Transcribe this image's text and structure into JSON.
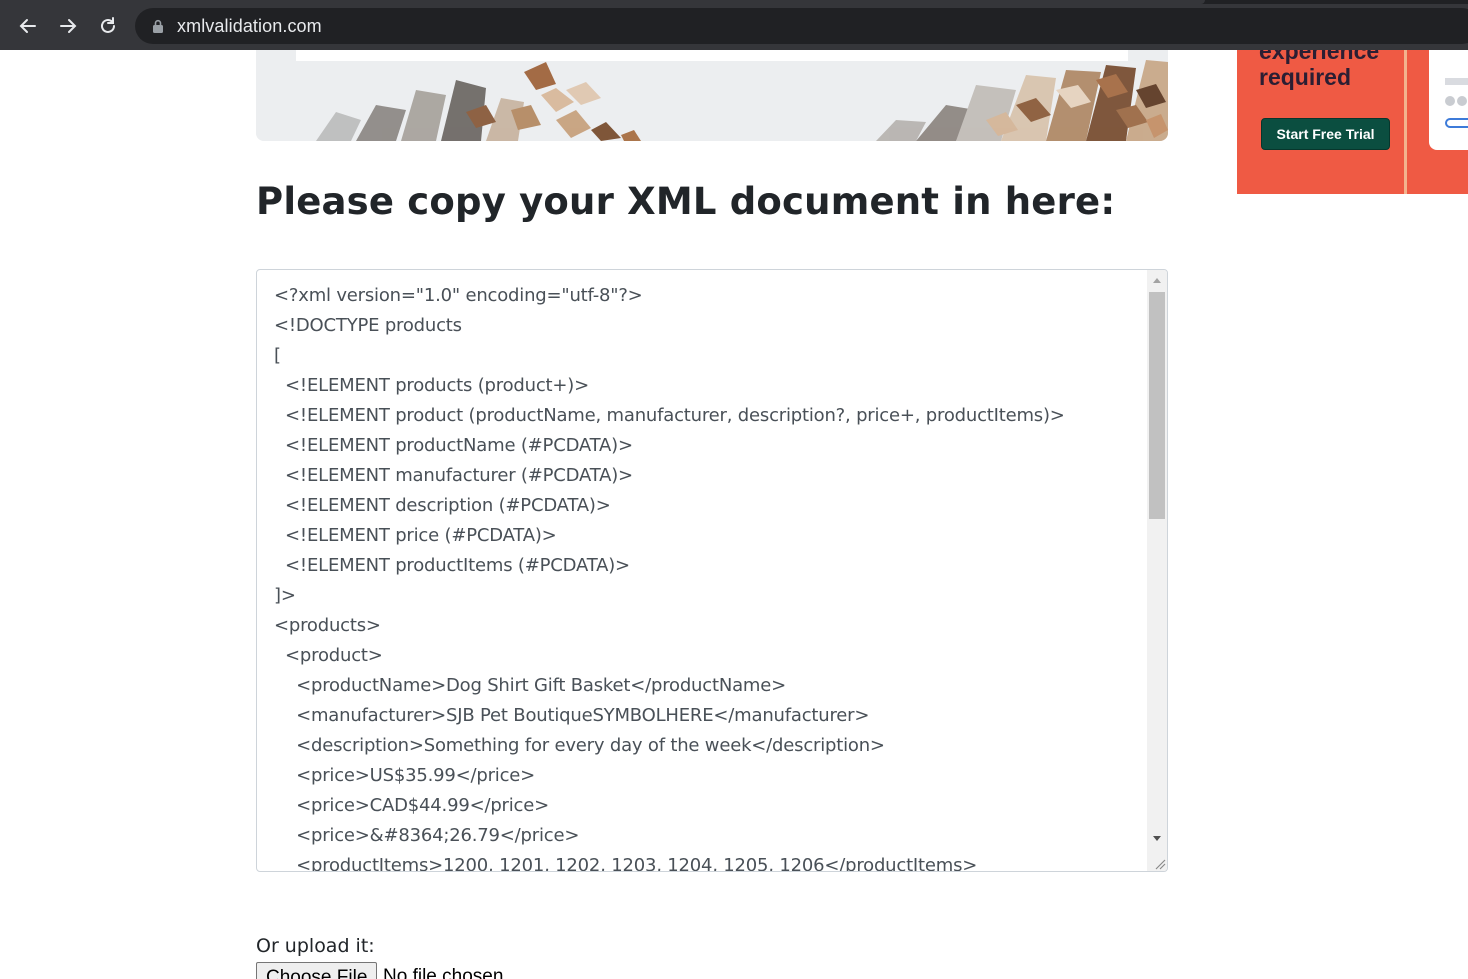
{
  "browser": {
    "url": "xmlvalidation.com"
  },
  "ad": {
    "headline_line1": "experience",
    "headline_line2": "required",
    "cta_label": "Start Free Trial",
    "background_color": "#ef5a44",
    "cta_color": "#0b4e40"
  },
  "main": {
    "title": "Please copy your XML document in here:",
    "xml_content": "<?xml version=\"1.0\" encoding=\"utf-8\"?>\n<!DOCTYPE products\n[\n  <!ELEMENT products (product+)>\n  <!ELEMENT product (productName, manufacturer, description?, price+, productItems)>\n  <!ELEMENT productName (#PCDATA)>\n  <!ELEMENT manufacturer (#PCDATA)>\n  <!ELEMENT description (#PCDATA)>\n  <!ELEMENT price (#PCDATA)>\n  <!ELEMENT productItems (#PCDATA)>\n]>\n<products>\n  <product>\n    <productName>Dog Shirt Gift Basket</productName>\n    <manufacturer>SJB Pet BoutiqueSYMBOLHERE</manufacturer>\n    <description>Something for every day of the week</description>\n    <price>US$35.99</price>\n    <price>CAD$44.99</price>\n    <price>&#8364;26.79</price>\n    <productItems>1200, 1201, 1202, 1203, 1204, 1205, 1206</productItems>"
  },
  "upload": {
    "label": "Or upload it:",
    "button_label": "Choose File",
    "status": "No file chosen"
  }
}
